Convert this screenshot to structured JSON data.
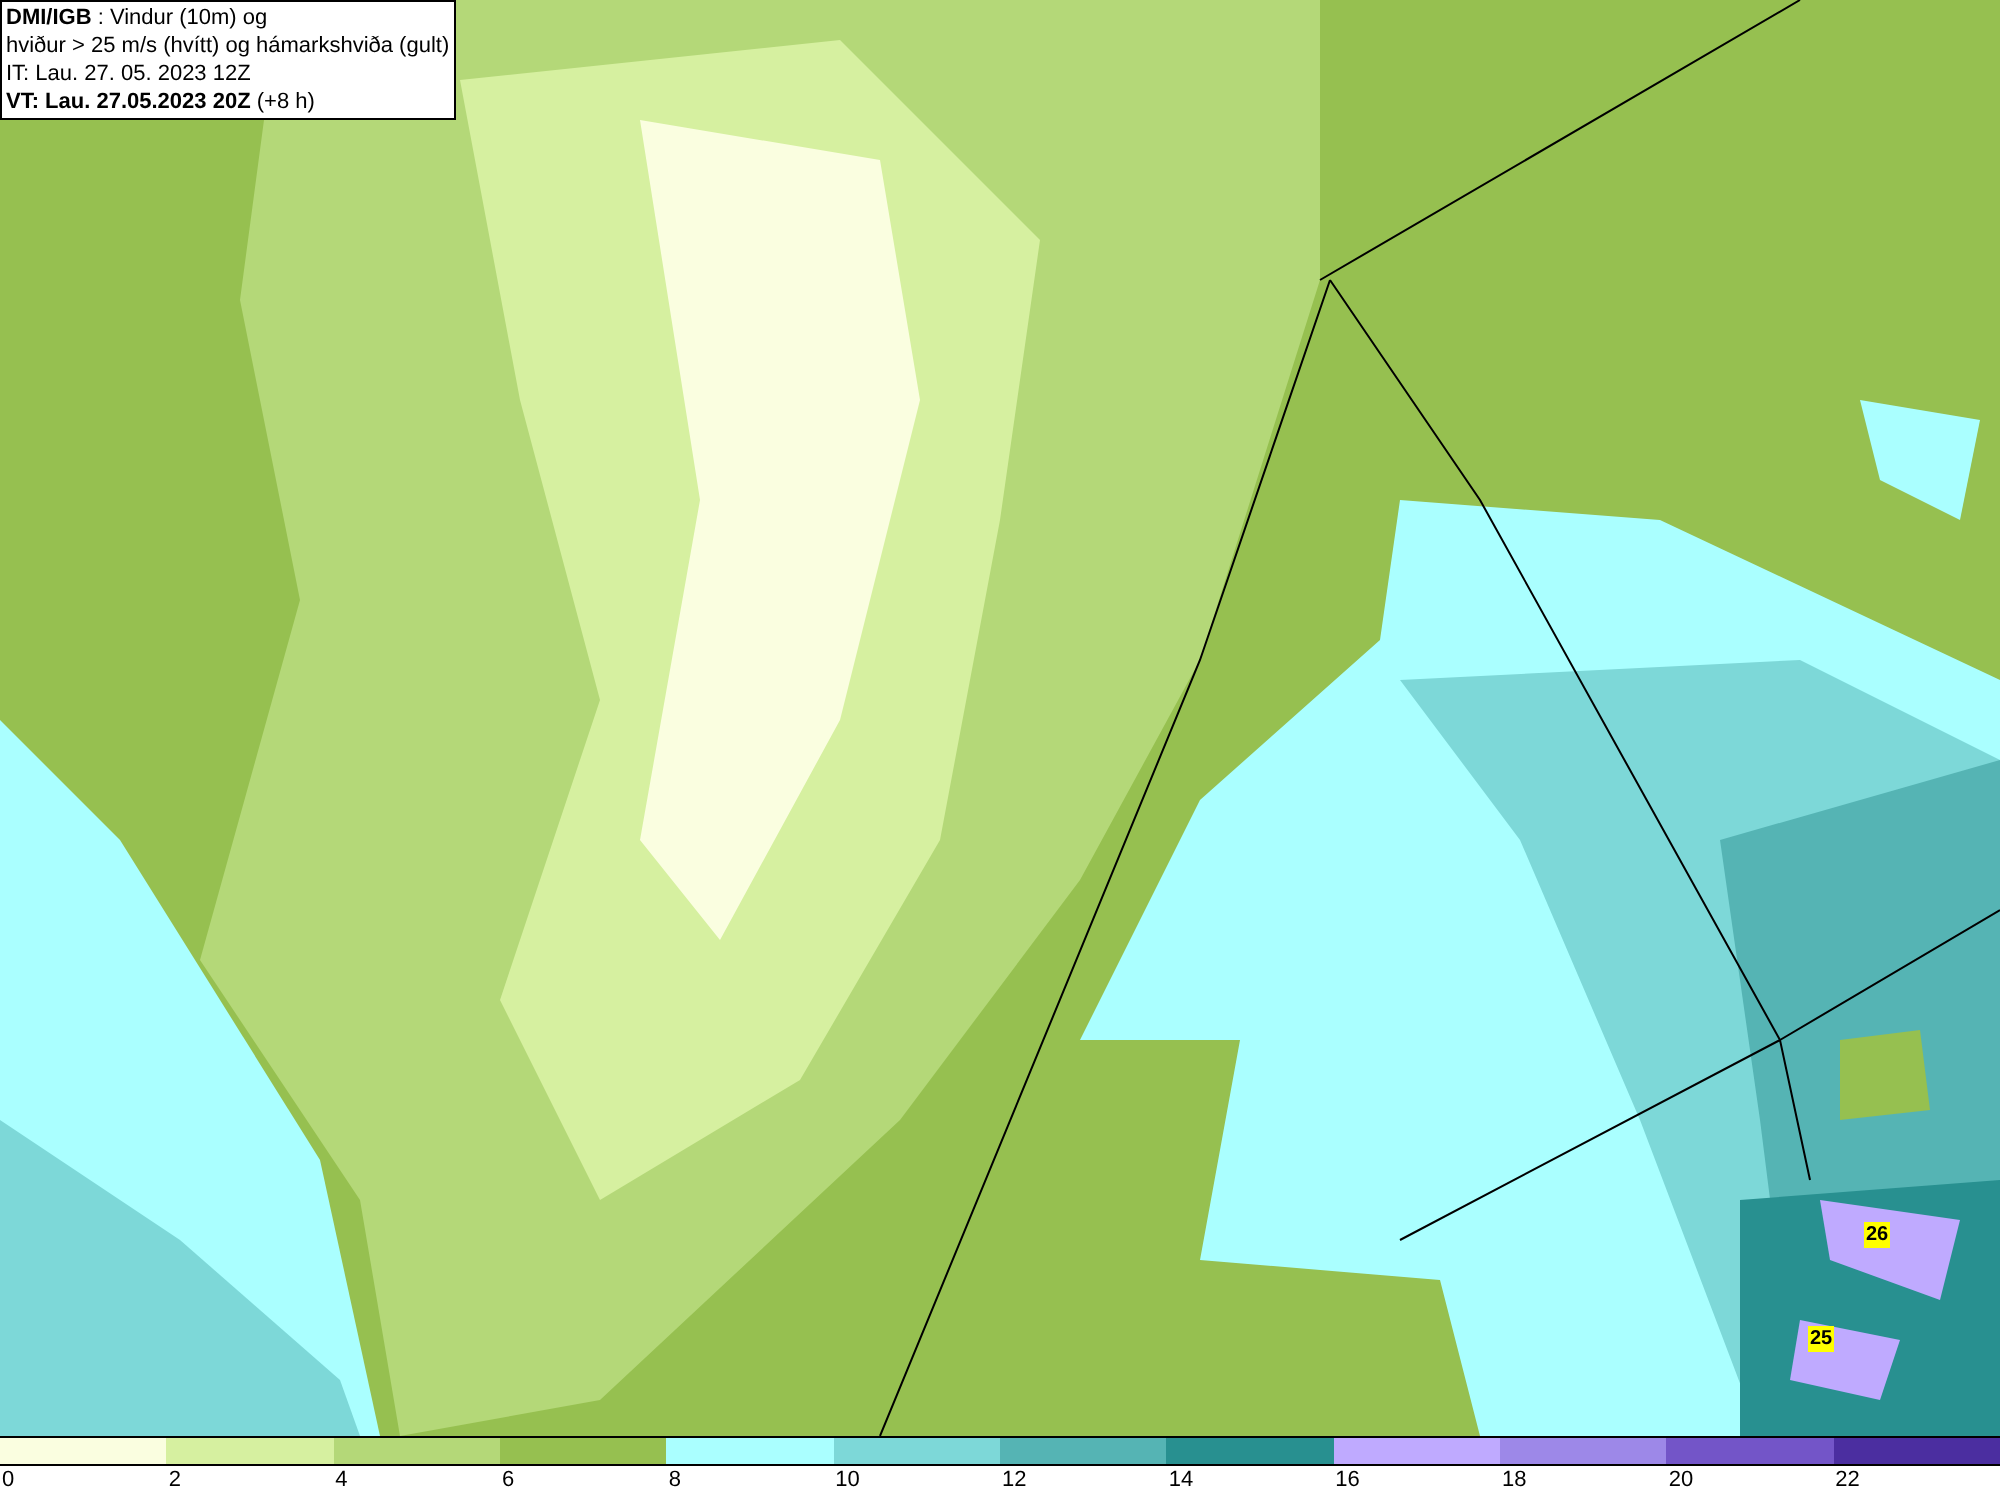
{
  "header": {
    "lines": [
      "**DMI/IGB** : Vindur (10m) og",
      "hviður > 25 m/s (hvítt) og hámarkshviða (gult)",
      "IT: Lau. 27. 05. 2023 12Z",
      "**VT: Lau. 27.05.2023 20Z** (+8 h)"
    ]
  },
  "map": {
    "gust_markers": [
      "26",
      "25"
    ]
  },
  "legend": [
    {
      "label": "0",
      "color": "#fafee0"
    },
    {
      "label": "2",
      "color": "#d6f0a0"
    },
    {
      "label": "4",
      "color": "#b4d878"
    },
    {
      "label": "6",
      "color": "#96c050"
    },
    {
      "label": "8",
      "color": "#aaffff"
    },
    {
      "label": "10",
      "color": "#7dd8d8"
    },
    {
      "label": "12",
      "color": "#55b4b4"
    },
    {
      "label": "14",
      "color": "#289090"
    },
    {
      "label": "16",
      "color": "#bfaaff"
    },
    {
      "label": "18",
      "color": "#9d88e8"
    },
    {
      "label": "20",
      "color": "#7355c8"
    },
    {
      "label": "22",
      "color": "#4b2ea0"
    }
  ]
}
